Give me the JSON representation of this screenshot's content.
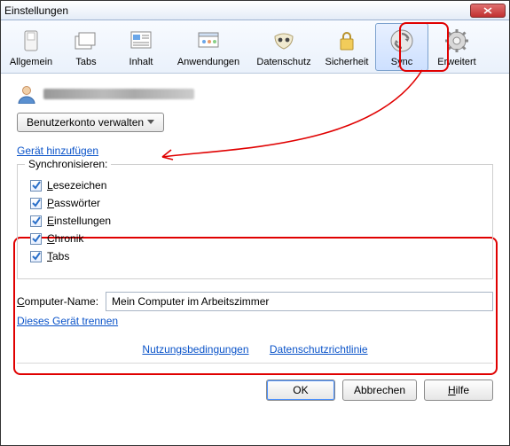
{
  "window": {
    "title": "Einstellungen"
  },
  "toolbar": {
    "items": [
      {
        "label": "Allgemein"
      },
      {
        "label": "Tabs"
      },
      {
        "label": "Inhalt"
      },
      {
        "label": "Anwendungen"
      },
      {
        "label": "Datenschutz"
      },
      {
        "label": "Sicherheit"
      },
      {
        "label": "Sync"
      },
      {
        "label": "Erweitert"
      }
    ]
  },
  "account": {
    "manage_button": "Benutzerkonto verwalten",
    "add_device_link": "Gerät hinzufügen"
  },
  "sync": {
    "legend": "Synchronisieren:",
    "items": [
      {
        "label": "Lesezeichen",
        "checked": true
      },
      {
        "label": "Passwörter",
        "checked": true
      },
      {
        "label": "Einstellungen",
        "checked": true
      },
      {
        "label": "Chronik",
        "checked": true
      },
      {
        "label": "Tabs",
        "checked": true
      }
    ]
  },
  "computer": {
    "label": "Computer-Name:",
    "value": "Mein Computer im Arbeitszimmer",
    "disconnect_link": "Dieses Gerät trennen"
  },
  "footer": {
    "terms": "Nutzungsbedingungen",
    "privacy": "Datenschutzrichtlinie",
    "ok": "OK",
    "cancel": "Abbrechen",
    "help": "Hilfe"
  }
}
